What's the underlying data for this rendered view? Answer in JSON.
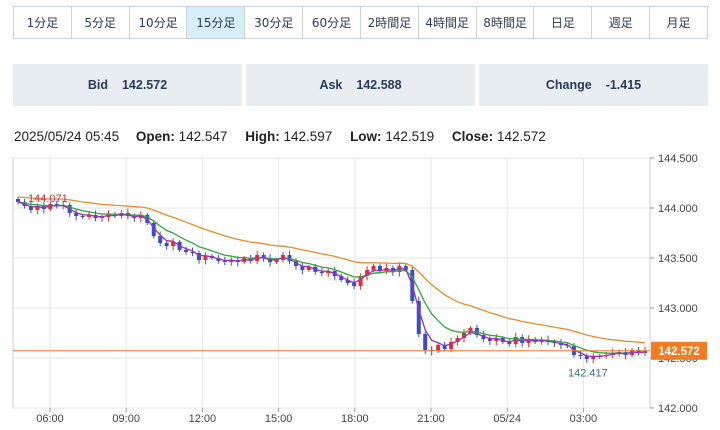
{
  "tabs": [
    {
      "label": "1分足",
      "active": false
    },
    {
      "label": "5分足",
      "active": false
    },
    {
      "label": "10分足",
      "active": false
    },
    {
      "label": "15分足",
      "active": true
    },
    {
      "label": "30分足",
      "active": false
    },
    {
      "label": "60分足",
      "active": false
    },
    {
      "label": "2時間足",
      "active": false
    },
    {
      "label": "4時間足",
      "active": false
    },
    {
      "label": "8時間足",
      "active": false
    },
    {
      "label": "日足",
      "active": false
    },
    {
      "label": "週足",
      "active": false
    },
    {
      "label": "月足",
      "active": false
    }
  ],
  "quotes": {
    "bid_label": "Bid",
    "bid_value": "142.572",
    "ask_label": "Ask",
    "ask_value": "142.588",
    "change_label": "Change",
    "change_value": "-1.415"
  },
  "ohlc": {
    "datetime": "2025/05/24 05:45",
    "open_label": "Open:",
    "open": "142.547",
    "high_label": "High:",
    "high": "142.597",
    "low_label": "Low:",
    "low": "142.519",
    "close_label": "Close:",
    "close": "142.572"
  },
  "chart_data": {
    "type": "candlestick",
    "ylim": [
      142.0,
      144.5
    ],
    "y_ticks": [
      "144.500",
      "144.000",
      "143.500",
      "143.000",
      "142.500",
      "142.000"
    ],
    "x_ticks": [
      "06:00",
      "09:00",
      "12:00",
      "15:00",
      "18:00",
      "21:00",
      "05/24",
      "03:00"
    ],
    "last_price_label": "142.572",
    "last_price": 142.572,
    "high_annotation": {
      "label": "144.071",
      "value": 144.071
    },
    "low_annotation": {
      "label": "142.417",
      "value": 142.417
    },
    "close_path": [
      144.06,
      144.02,
      143.98,
      144.02,
      143.99,
      144.04,
      144.02,
      144.03,
      143.95,
      143.92,
      143.91,
      143.93,
      143.9,
      143.91,
      143.94,
      143.92,
      143.95,
      143.92,
      143.9,
      143.93,
      143.85,
      143.72,
      143.65,
      143.62,
      143.66,
      143.58,
      143.56,
      143.55,
      143.48,
      143.52,
      143.5,
      143.47,
      143.46,
      143.48,
      143.46,
      143.5,
      143.47,
      143.53,
      143.5,
      143.46,
      143.48,
      143.53,
      143.47,
      143.42,
      143.38,
      143.41,
      143.36,
      143.35,
      143.37,
      143.32,
      143.28,
      143.25,
      143.22,
      143.32,
      143.38,
      143.42,
      143.37,
      143.4,
      143.36,
      143.42,
      143.38,
      143.07,
      142.74,
      142.58,
      142.57,
      142.63,
      142.59,
      142.66,
      142.7,
      142.75,
      142.8,
      142.73,
      142.69,
      142.67,
      142.7,
      142.66,
      142.64,
      142.71,
      142.65,
      142.69,
      142.66,
      142.68,
      142.66,
      142.65,
      142.63,
      142.62,
      142.53,
      142.52,
      142.49,
      142.51,
      142.52,
      142.53,
      142.55,
      142.56,
      142.53,
      142.58,
      142.55,
      142.57
    ],
    "series": [
      {
        "name": "",
        "color": "#2eaa3a",
        "period": 8
      },
      {
        "name": "",
        "color": "#f08a24",
        "period": 21
      },
      {
        "name": "",
        "color": "#9a2fc2",
        "period": 3
      }
    ],
    "colors": {
      "up": "#e03030",
      "down": "#3a4fc0",
      "price_line": "#f47b20",
      "bg": "#ffffff",
      "grid": "#e6e6e6"
    }
  }
}
